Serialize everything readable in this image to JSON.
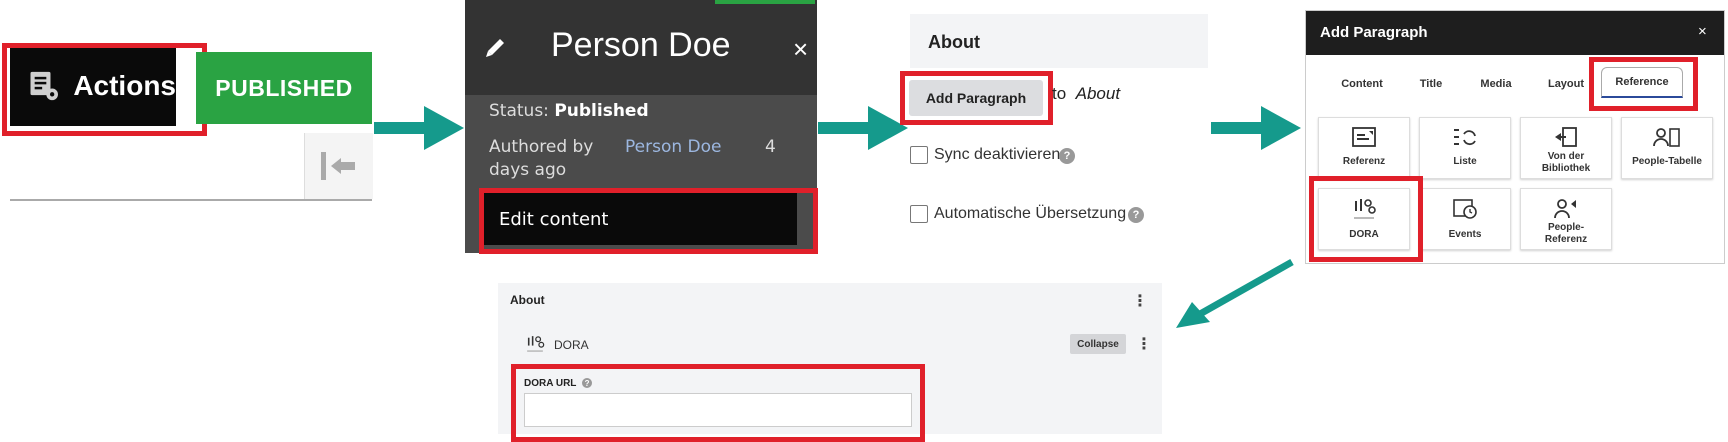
{
  "step1": {
    "actions_label": "Actions",
    "actions_icon": "document-gear-icon",
    "status_badge": "PUBLISHED",
    "collapse_icon": "collapse-left-icon"
  },
  "step2": {
    "title": "Person Doe",
    "close": "×",
    "edit_icon": "pencil-icon",
    "status_prefix": "Status:",
    "status_value": "Published",
    "authored_prefix": "Authored by",
    "author": "Person Doe",
    "authored_num": "4",
    "authored_suffix": "days ago",
    "edit_button": "Edit content"
  },
  "step3": {
    "heading": "About",
    "add_button": "Add Paragraph",
    "to_text": "to",
    "to_target": "About",
    "sync_label": "Sync deaktivieren",
    "auto_label": "Automatische Übersetzung",
    "help_symbol": "?"
  },
  "step4": {
    "title": "Add Paragraph",
    "close": "×",
    "tabs": [
      "Content",
      "Title",
      "Media",
      "Layout",
      "Reference"
    ],
    "active_tab": "Reference",
    "tiles": [
      {
        "label": "Referenz",
        "icon": "reference-icon"
      },
      {
        "label": "Liste",
        "icon": "list-refresh-icon"
      },
      {
        "label": "Von der",
        "label2": "Bibliothek",
        "icon": "library-icon"
      },
      {
        "label": "People-Tabelle",
        "icon": "people-table-icon"
      },
      {
        "label": "DORA",
        "icon": "dora-icon"
      },
      {
        "label": "Events",
        "icon": "events-clock-icon"
      },
      {
        "label": "People-",
        "label2": "Referenz",
        "icon": "people-reference-icon"
      }
    ]
  },
  "step5": {
    "heading": "About",
    "menu": "⋮",
    "paragraph_title": "DORA",
    "collapse_button": "Collapse",
    "field_label": "DORA URL",
    "field_value": "",
    "help_symbol": "?"
  },
  "colors": {
    "highlight": "#e0202a",
    "arrow": "#159a8c",
    "published_green": "#2aa343"
  }
}
